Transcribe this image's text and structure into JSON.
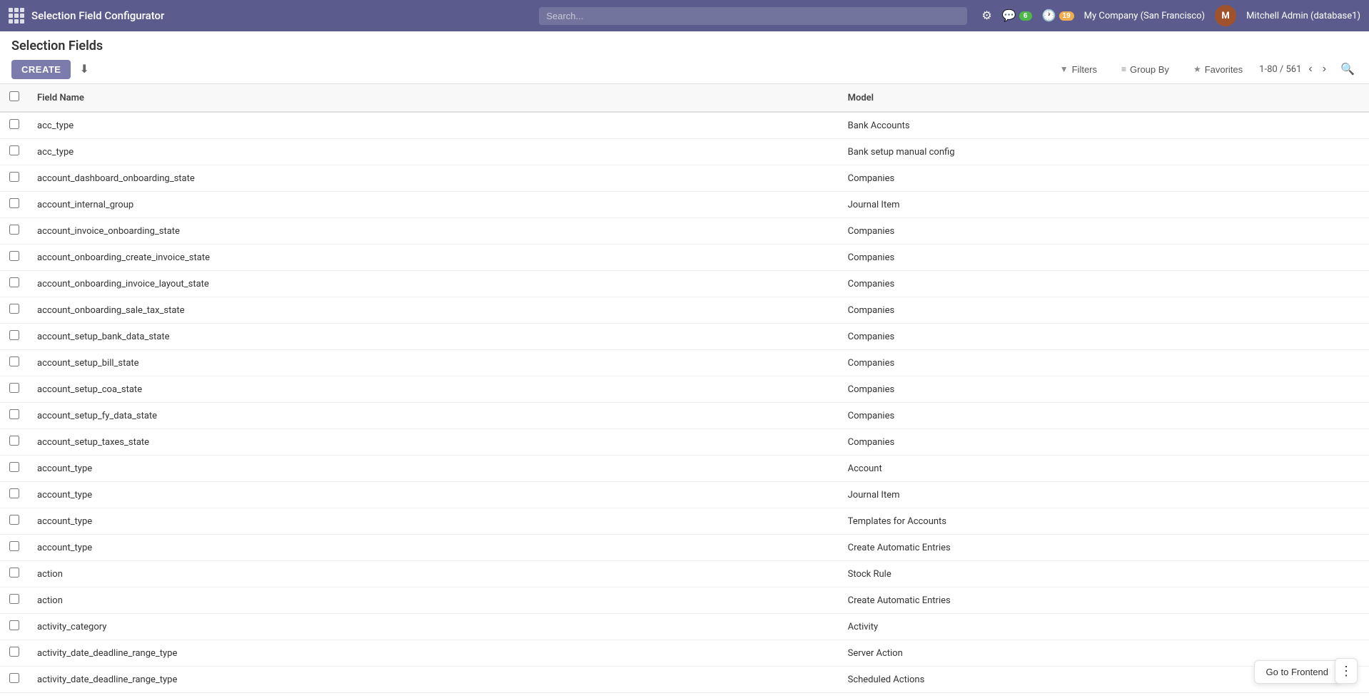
{
  "app": {
    "grid_icon": "apps-icon",
    "title": "Selection Field Configurator"
  },
  "topnav": {
    "search_placeholder": "Search...",
    "notifications_badge": "6",
    "clock_badge": "19",
    "company": "My Company (San Francisco)",
    "user": "Mitchell Admin (database1)",
    "avatar_initials": "M"
  },
  "page": {
    "title": "Selection Fields"
  },
  "toolbar": {
    "create_label": "CREATE",
    "filters_label": "Filters",
    "group_by_label": "Group By",
    "favorites_label": "Favorites",
    "pagination": "1-80 / 561"
  },
  "table": {
    "columns": [
      {
        "key": "field_name",
        "label": "Field Name"
      },
      {
        "key": "model",
        "label": "Model"
      }
    ],
    "rows": [
      {
        "field_name": "acc_type",
        "model": "Bank Accounts"
      },
      {
        "field_name": "acc_type",
        "model": "Bank setup manual config"
      },
      {
        "field_name": "account_dashboard_onboarding_state",
        "model": "Companies"
      },
      {
        "field_name": "account_internal_group",
        "model": "Journal Item"
      },
      {
        "field_name": "account_invoice_onboarding_state",
        "model": "Companies"
      },
      {
        "field_name": "account_onboarding_create_invoice_state",
        "model": "Companies"
      },
      {
        "field_name": "account_onboarding_invoice_layout_state",
        "model": "Companies"
      },
      {
        "field_name": "account_onboarding_sale_tax_state",
        "model": "Companies"
      },
      {
        "field_name": "account_setup_bank_data_state",
        "model": "Companies"
      },
      {
        "field_name": "account_setup_bill_state",
        "model": "Companies"
      },
      {
        "field_name": "account_setup_coa_state",
        "model": "Companies"
      },
      {
        "field_name": "account_setup_fy_data_state",
        "model": "Companies"
      },
      {
        "field_name": "account_setup_taxes_state",
        "model": "Companies"
      },
      {
        "field_name": "account_type",
        "model": "Account"
      },
      {
        "field_name": "account_type",
        "model": "Journal Item"
      },
      {
        "field_name": "account_type",
        "model": "Templates for Accounts"
      },
      {
        "field_name": "account_type",
        "model": "Create Automatic Entries"
      },
      {
        "field_name": "action",
        "model": "Stock Rule"
      },
      {
        "field_name": "action",
        "model": "Create Automatic Entries"
      },
      {
        "field_name": "activity_category",
        "model": "Activity"
      },
      {
        "field_name": "activity_date_deadline_range_type",
        "model": "Server Action"
      },
      {
        "field_name": "activity_date_deadline_range_type",
        "model": "Scheduled Actions"
      }
    ]
  },
  "floating": {
    "goto_label": "Go to Frontend",
    "more_label": "⋮"
  }
}
